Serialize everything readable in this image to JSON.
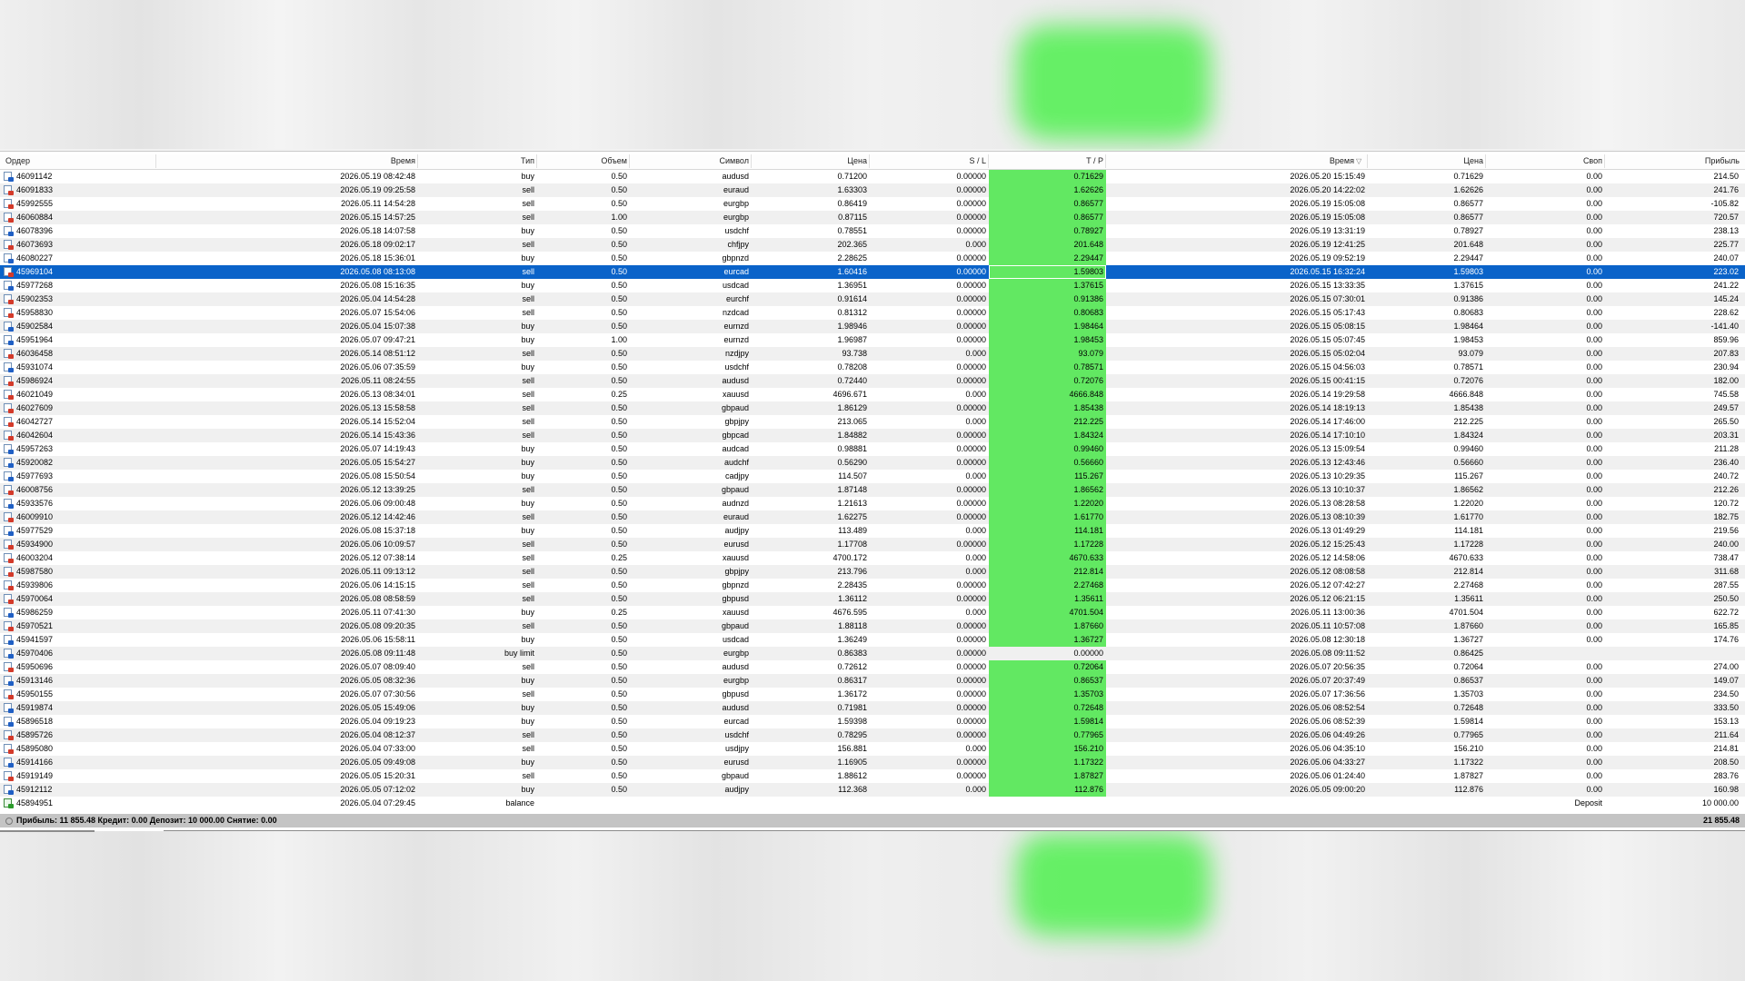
{
  "columns": {
    "order": "Ордер",
    "open_time": "Время",
    "type": "Тип",
    "volume": "Объем",
    "symbol": "Символ",
    "open_price": "Цена",
    "sl": "S / L",
    "tp": "T / P",
    "close_time": "Время",
    "close_price": "Цена",
    "swap": "Своп",
    "profit": "Прибыль"
  },
  "sort_indicator": "▽",
  "rows": [
    {
      "order": "46091142",
      "open_time": "2026.05.19 08:42:48",
      "type": "buy",
      "volume": "0.50",
      "symbol": "audusd",
      "open_price": "0.71200",
      "sl": "0.00000",
      "tp": "0.71629",
      "close_time": "2026.05.20 15:15:49",
      "close_price": "0.71629",
      "swap": "0.00",
      "profit": "214.50",
      "tp_hit": true
    },
    {
      "order": "46091833",
      "open_time": "2026.05.19 09:25:58",
      "type": "sell",
      "volume": "0.50",
      "symbol": "euraud",
      "open_price": "1.63303",
      "sl": "0.00000",
      "tp": "1.62626",
      "close_time": "2026.05.20 14:22:02",
      "close_price": "1.62626",
      "swap": "0.00",
      "profit": "241.76",
      "tp_hit": true
    },
    {
      "order": "45992555",
      "open_time": "2026.05.11 14:54:28",
      "type": "sell",
      "volume": "0.50",
      "symbol": "eurgbp",
      "open_price": "0.86419",
      "sl": "0.00000",
      "tp": "0.86577",
      "close_time": "2026.05.19 15:05:08",
      "close_price": "0.86577",
      "swap": "0.00",
      "profit": "-105.82",
      "tp_hit": true
    },
    {
      "order": "46060884",
      "open_time": "2026.05.15 14:57:25",
      "type": "sell",
      "volume": "1.00",
      "symbol": "eurgbp",
      "open_price": "0.87115",
      "sl": "0.00000",
      "tp": "0.86577",
      "close_time": "2026.05.19 15:05:08",
      "close_price": "0.86577",
      "swap": "0.00",
      "profit": "720.57",
      "tp_hit": true
    },
    {
      "order": "46078396",
      "open_time": "2026.05.18 14:07:58",
      "type": "buy",
      "volume": "0.50",
      "symbol": "usdchf",
      "open_price": "0.78551",
      "sl": "0.00000",
      "tp": "0.78927",
      "close_time": "2026.05.19 13:31:19",
      "close_price": "0.78927",
      "swap": "0.00",
      "profit": "238.13",
      "tp_hit": true
    },
    {
      "order": "46073693",
      "open_time": "2026.05.18 09:02:17",
      "type": "sell",
      "volume": "0.50",
      "symbol": "chfjpy",
      "open_price": "202.365",
      "sl": "0.000",
      "tp": "201.648",
      "close_time": "2026.05.19 12:41:25",
      "close_price": "201.648",
      "swap": "0.00",
      "profit": "225.77",
      "tp_hit": true
    },
    {
      "order": "46080227",
      "open_time": "2026.05.18 15:36:01",
      "type": "buy",
      "volume": "0.50",
      "symbol": "gbpnzd",
      "open_price": "2.28625",
      "sl": "0.00000",
      "tp": "2.29447",
      "close_time": "2026.05.19 09:52:19",
      "close_price": "2.29447",
      "swap": "0.00",
      "profit": "240.07",
      "tp_hit": true
    },
    {
      "order": "45969104",
      "open_time": "2026.05.08 08:13:08",
      "type": "sell",
      "volume": "0.50",
      "symbol": "eurcad",
      "open_price": "1.60416",
      "sl": "0.00000",
      "tp": "1.59803",
      "close_time": "2026.05.15 16:32:24",
      "close_price": "1.59803",
      "swap": "0.00",
      "profit": "223.02",
      "tp_hit": true,
      "selected": true
    },
    {
      "order": "45977268",
      "open_time": "2026.05.08 15:16:35",
      "type": "buy",
      "volume": "0.50",
      "symbol": "usdcad",
      "open_price": "1.36951",
      "sl": "0.00000",
      "tp": "1.37615",
      "close_time": "2026.05.15 13:33:35",
      "close_price": "1.37615",
      "swap": "0.00",
      "profit": "241.22",
      "tp_hit": true
    },
    {
      "order": "45902353",
      "open_time": "2026.05.04 14:54:28",
      "type": "sell",
      "volume": "0.50",
      "symbol": "eurchf",
      "open_price": "0.91614",
      "sl": "0.00000",
      "tp": "0.91386",
      "close_time": "2026.05.15 07:30:01",
      "close_price": "0.91386",
      "swap": "0.00",
      "profit": "145.24",
      "tp_hit": true
    },
    {
      "order": "45958830",
      "open_time": "2026.05.07 15:54:06",
      "type": "sell",
      "volume": "0.50",
      "symbol": "nzdcad",
      "open_price": "0.81312",
      "sl": "0.00000",
      "tp": "0.80683",
      "close_time": "2026.05.15 05:17:43",
      "close_price": "0.80683",
      "swap": "0.00",
      "profit": "228.62",
      "tp_hit": true
    },
    {
      "order": "45902584",
      "open_time": "2026.05.04 15:07:38",
      "type": "buy",
      "volume": "0.50",
      "symbol": "eurnzd",
      "open_price": "1.98946",
      "sl": "0.00000",
      "tp": "1.98464",
      "close_time": "2026.05.15 05:08:15",
      "close_price": "1.98464",
      "swap": "0.00",
      "profit": "-141.40",
      "tp_hit": true
    },
    {
      "order": "45951964",
      "open_time": "2026.05.07 09:47:21",
      "type": "buy",
      "volume": "1.00",
      "symbol": "eurnzd",
      "open_price": "1.96987",
      "sl": "0.00000",
      "tp": "1.98453",
      "close_time": "2026.05.15 05:07:45",
      "close_price": "1.98453",
      "swap": "0.00",
      "profit": "859.96",
      "tp_hit": true
    },
    {
      "order": "46036458",
      "open_time": "2026.05.14 08:51:12",
      "type": "sell",
      "volume": "0.50",
      "symbol": "nzdjpy",
      "open_price": "93.738",
      "sl": "0.000",
      "tp": "93.079",
      "close_time": "2026.05.15 05:02:04",
      "close_price": "93.079",
      "swap": "0.00",
      "profit": "207.83",
      "tp_hit": true
    },
    {
      "order": "45931074",
      "open_time": "2026.05.06 07:35:59",
      "type": "buy",
      "volume": "0.50",
      "symbol": "usdchf",
      "open_price": "0.78208",
      "sl": "0.00000",
      "tp": "0.78571",
      "close_time": "2026.05.15 04:56:03",
      "close_price": "0.78571",
      "swap": "0.00",
      "profit": "230.94",
      "tp_hit": true
    },
    {
      "order": "45986924",
      "open_time": "2026.05.11 08:24:55",
      "type": "sell",
      "volume": "0.50",
      "symbol": "audusd",
      "open_price": "0.72440",
      "sl": "0.00000",
      "tp": "0.72076",
      "close_time": "2026.05.15 00:41:15",
      "close_price": "0.72076",
      "swap": "0.00",
      "profit": "182.00",
      "tp_hit": true
    },
    {
      "order": "46021049",
      "open_time": "2026.05.13 08:34:01",
      "type": "sell",
      "volume": "0.25",
      "symbol": "xauusd",
      "open_price": "4696.671",
      "sl": "0.000",
      "tp": "4666.848",
      "close_time": "2026.05.14 19:29:58",
      "close_price": "4666.848",
      "swap": "0.00",
      "profit": "745.58",
      "tp_hit": true
    },
    {
      "order": "46027609",
      "open_time": "2026.05.13 15:58:58",
      "type": "sell",
      "volume": "0.50",
      "symbol": "gbpaud",
      "open_price": "1.86129",
      "sl": "0.00000",
      "tp": "1.85438",
      "close_time": "2026.05.14 18:19:13",
      "close_price": "1.85438",
      "swap": "0.00",
      "profit": "249.57",
      "tp_hit": true
    },
    {
      "order": "46042727",
      "open_time": "2026.05.14 15:52:04",
      "type": "sell",
      "volume": "0.50",
      "symbol": "gbpjpy",
      "open_price": "213.065",
      "sl": "0.000",
      "tp": "212.225",
      "close_time": "2026.05.14 17:46:00",
      "close_price": "212.225",
      "swap": "0.00",
      "profit": "265.50",
      "tp_hit": true
    },
    {
      "order": "46042604",
      "open_time": "2026.05.14 15:43:36",
      "type": "sell",
      "volume": "0.50",
      "symbol": "gbpcad",
      "open_price": "1.84882",
      "sl": "0.00000",
      "tp": "1.84324",
      "close_time": "2026.05.14 17:10:10",
      "close_price": "1.84324",
      "swap": "0.00",
      "profit": "203.31",
      "tp_hit": true
    },
    {
      "order": "45957263",
      "open_time": "2026.05.07 14:19:43",
      "type": "buy",
      "volume": "0.50",
      "symbol": "audcad",
      "open_price": "0.98881",
      "sl": "0.00000",
      "tp": "0.99460",
      "close_time": "2026.05.13 15:09:54",
      "close_price": "0.99460",
      "swap": "0.00",
      "profit": "211.28",
      "tp_hit": true
    },
    {
      "order": "45920082",
      "open_time": "2026.05.05 15:54:27",
      "type": "buy",
      "volume": "0.50",
      "symbol": "audchf",
      "open_price": "0.56290",
      "sl": "0.00000",
      "tp": "0.56660",
      "close_time": "2026.05.13 12:43:46",
      "close_price": "0.56660",
      "swap": "0.00",
      "profit": "236.40",
      "tp_hit": true
    },
    {
      "order": "45977693",
      "open_time": "2026.05.08 15:50:54",
      "type": "buy",
      "volume": "0.50",
      "symbol": "cadjpy",
      "open_price": "114.507",
      "sl": "0.000",
      "tp": "115.267",
      "close_time": "2026.05.13 10:29:35",
      "close_price": "115.267",
      "swap": "0.00",
      "profit": "240.72",
      "tp_hit": true
    },
    {
      "order": "46008756",
      "open_time": "2026.05.12 13:39:25",
      "type": "sell",
      "volume": "0.50",
      "symbol": "gbpaud",
      "open_price": "1.87148",
      "sl": "0.00000",
      "tp": "1.86562",
      "close_time": "2026.05.13 10:10:37",
      "close_price": "1.86562",
      "swap": "0.00",
      "profit": "212.26",
      "tp_hit": true
    },
    {
      "order": "45933576",
      "open_time": "2026.05.06 09:00:48",
      "type": "buy",
      "volume": "0.50",
      "symbol": "audnzd",
      "open_price": "1.21613",
      "sl": "0.00000",
      "tp": "1.22020",
      "close_time": "2026.05.13 08:28:58",
      "close_price": "1.22020",
      "swap": "0.00",
      "profit": "120.72",
      "tp_hit": true
    },
    {
      "order": "46009910",
      "open_time": "2026.05.12 14:42:46",
      "type": "sell",
      "volume": "0.50",
      "symbol": "euraud",
      "open_price": "1.62275",
      "sl": "0.00000",
      "tp": "1.61770",
      "close_time": "2026.05.13 08:10:39",
      "close_price": "1.61770",
      "swap": "0.00",
      "profit": "182.75",
      "tp_hit": true
    },
    {
      "order": "45977529",
      "open_time": "2026.05.08 15:37:18",
      "type": "buy",
      "volume": "0.50",
      "symbol": "audjpy",
      "open_price": "113.489",
      "sl": "0.000",
      "tp": "114.181",
      "close_time": "2026.05.13 01:49:29",
      "close_price": "114.181",
      "swap": "0.00",
      "profit": "219.56",
      "tp_hit": true
    },
    {
      "order": "45934900",
      "open_time": "2026.05.06 10:09:57",
      "type": "sell",
      "volume": "0.50",
      "symbol": "eurusd",
      "open_price": "1.17708",
      "sl": "0.00000",
      "tp": "1.17228",
      "close_time": "2026.05.12 15:25:43",
      "close_price": "1.17228",
      "swap": "0.00",
      "profit": "240.00",
      "tp_hit": true
    },
    {
      "order": "46003204",
      "open_time": "2026.05.12 07:38:14",
      "type": "sell",
      "volume": "0.25",
      "symbol": "xauusd",
      "open_price": "4700.172",
      "sl": "0.000",
      "tp": "4670.633",
      "close_time": "2026.05.12 14:58:06",
      "close_price": "4670.633",
      "swap": "0.00",
      "profit": "738.47",
      "tp_hit": true
    },
    {
      "order": "45987580",
      "open_time": "2026.05.11 09:13:12",
      "type": "sell",
      "volume": "0.50",
      "symbol": "gbpjpy",
      "open_price": "213.796",
      "sl": "0.000",
      "tp": "212.814",
      "close_time": "2026.05.12 08:08:58",
      "close_price": "212.814",
      "swap": "0.00",
      "profit": "311.68",
      "tp_hit": true
    },
    {
      "order": "45939806",
      "open_time": "2026.05.06 14:15:15",
      "type": "sell",
      "volume": "0.50",
      "symbol": "gbpnzd",
      "open_price": "2.28435",
      "sl": "0.00000",
      "tp": "2.27468",
      "close_time": "2026.05.12 07:42:27",
      "close_price": "2.27468",
      "swap": "0.00",
      "profit": "287.55",
      "tp_hit": true
    },
    {
      "order": "45970064",
      "open_time": "2026.05.08 08:58:59",
      "type": "sell",
      "volume": "0.50",
      "symbol": "gbpusd",
      "open_price": "1.36112",
      "sl": "0.00000",
      "tp": "1.35611",
      "close_time": "2026.05.12 06:21:15",
      "close_price": "1.35611",
      "swap": "0.00",
      "profit": "250.50",
      "tp_hit": true
    },
    {
      "order": "45986259",
      "open_time": "2026.05.11 07:41:30",
      "type": "buy",
      "volume": "0.25",
      "symbol": "xauusd",
      "open_price": "4676.595",
      "sl": "0.000",
      "tp": "4701.504",
      "close_time": "2026.05.11 13:00:36",
      "close_price": "4701.504",
      "swap": "0.00",
      "profit": "622.72",
      "tp_hit": true
    },
    {
      "order": "45970521",
      "open_time": "2026.05.08 09:20:35",
      "type": "sell",
      "volume": "0.50",
      "symbol": "gbpaud",
      "open_price": "1.88118",
      "sl": "0.00000",
      "tp": "1.87660",
      "close_time": "2026.05.11 10:57:08",
      "close_price": "1.87660",
      "swap": "0.00",
      "profit": "165.85",
      "tp_hit": true
    },
    {
      "order": "45941597",
      "open_time": "2026.05.06 15:58:11",
      "type": "buy",
      "volume": "0.50",
      "symbol": "usdcad",
      "open_price": "1.36249",
      "sl": "0.00000",
      "tp": "1.36727",
      "close_time": "2026.05.08 12:30:18",
      "close_price": "1.36727",
      "swap": "0.00",
      "profit": "174.76",
      "tp_hit": true
    },
    {
      "order": "45970406",
      "open_time": "2026.05.08 09:11:48",
      "type": "buy limit",
      "volume": "0.50",
      "symbol": "eurgbp",
      "open_price": "0.86383",
      "sl": "0.00000",
      "tp": "0.00000",
      "close_time": "2026.05.08 09:11:52",
      "close_price": "0.86425",
      "swap": "",
      "profit": "",
      "tp_hit": false
    },
    {
      "order": "45950696",
      "open_time": "2026.05.07 08:09:40",
      "type": "sell",
      "volume": "0.50",
      "symbol": "audusd",
      "open_price": "0.72612",
      "sl": "0.00000",
      "tp": "0.72064",
      "close_time": "2026.05.07 20:56:35",
      "close_price": "0.72064",
      "swap": "0.00",
      "profit": "274.00",
      "tp_hit": true
    },
    {
      "order": "45913146",
      "open_time": "2026.05.05 08:32:36",
      "type": "buy",
      "volume": "0.50",
      "symbol": "eurgbp",
      "open_price": "0.86317",
      "sl": "0.00000",
      "tp": "0.86537",
      "close_time": "2026.05.07 20:37:49",
      "close_price": "0.86537",
      "swap": "0.00",
      "profit": "149.07",
      "tp_hit": true
    },
    {
      "order": "45950155",
      "open_time": "2026.05.07 07:30:56",
      "type": "sell",
      "volume": "0.50",
      "symbol": "gbpusd",
      "open_price": "1.36172",
      "sl": "0.00000",
      "tp": "1.35703",
      "close_time": "2026.05.07 17:36:56",
      "close_price": "1.35703",
      "swap": "0.00",
      "profit": "234.50",
      "tp_hit": true
    },
    {
      "order": "45919874",
      "open_time": "2026.05.05 15:49:06",
      "type": "buy",
      "volume": "0.50",
      "symbol": "audusd",
      "open_price": "0.71981",
      "sl": "0.00000",
      "tp": "0.72648",
      "close_time": "2026.05.06 08:52:54",
      "close_price": "0.72648",
      "swap": "0.00",
      "profit": "333.50",
      "tp_hit": true
    },
    {
      "order": "45896518",
      "open_time": "2026.05.04 09:19:23",
      "type": "buy",
      "volume": "0.50",
      "symbol": "eurcad",
      "open_price": "1.59398",
      "sl": "0.00000",
      "tp": "1.59814",
      "close_time": "2026.05.06 08:52:39",
      "close_price": "1.59814",
      "swap": "0.00",
      "profit": "153.13",
      "tp_hit": true
    },
    {
      "order": "45895726",
      "open_time": "2026.05.04 08:12:37",
      "type": "sell",
      "volume": "0.50",
      "symbol": "usdchf",
      "open_price": "0.78295",
      "sl": "0.00000",
      "tp": "0.77965",
      "close_time": "2026.05.06 04:49:26",
      "close_price": "0.77965",
      "swap": "0.00",
      "profit": "211.64",
      "tp_hit": true
    },
    {
      "order": "45895080",
      "open_time": "2026.05.04 07:33:00",
      "type": "sell",
      "volume": "0.50",
      "symbol": "usdjpy",
      "open_price": "156.881",
      "sl": "0.000",
      "tp": "156.210",
      "close_time": "2026.05.06 04:35:10",
      "close_price": "156.210",
      "swap": "0.00",
      "profit": "214.81",
      "tp_hit": true
    },
    {
      "order": "45914166",
      "open_time": "2026.05.05 09:49:08",
      "type": "buy",
      "volume": "0.50",
      "symbol": "eurusd",
      "open_price": "1.16905",
      "sl": "0.00000",
      "tp": "1.17322",
      "close_time": "2026.05.06 04:33:27",
      "close_price": "1.17322",
      "swap": "0.00",
      "profit": "208.50",
      "tp_hit": true
    },
    {
      "order": "45919149",
      "open_time": "2026.05.05 15:20:31",
      "type": "sell",
      "volume": "0.50",
      "symbol": "gbpaud",
      "open_price": "1.88612",
      "sl": "0.00000",
      "tp": "1.87827",
      "close_time": "2026.05.06 01:24:40",
      "close_price": "1.87827",
      "swap": "0.00",
      "profit": "283.76",
      "tp_hit": true
    },
    {
      "order": "45912112",
      "open_time": "2026.05.05 07:12:02",
      "type": "buy",
      "volume": "0.50",
      "symbol": "audjpy",
      "open_price": "112.368",
      "sl": "0.000",
      "tp": "112.876",
      "close_time": "2026.05.05 09:00:20",
      "close_price": "112.876",
      "swap": "0.00",
      "profit": "160.98",
      "tp_hit": true
    },
    {
      "order": "45894951",
      "open_time": "2026.05.04 07:29:45",
      "type": "balance",
      "volume": "",
      "symbol": "",
      "open_price": "",
      "sl": "",
      "tp": "",
      "close_time": "",
      "close_price": "",
      "swap": "Deposit",
      "profit": "10 000.00",
      "tp_hit": false
    }
  ],
  "summary": {
    "text": "Прибыль: 11 855.48  Кредит: 0.00  Депозит: 10 000.00  Снятие: 0.00",
    "total": "21 855.48"
  },
  "colors": {
    "selection": "#0a63c9",
    "tp_highlight": "#62e862",
    "summary_bar": "#c4c4c4"
  }
}
